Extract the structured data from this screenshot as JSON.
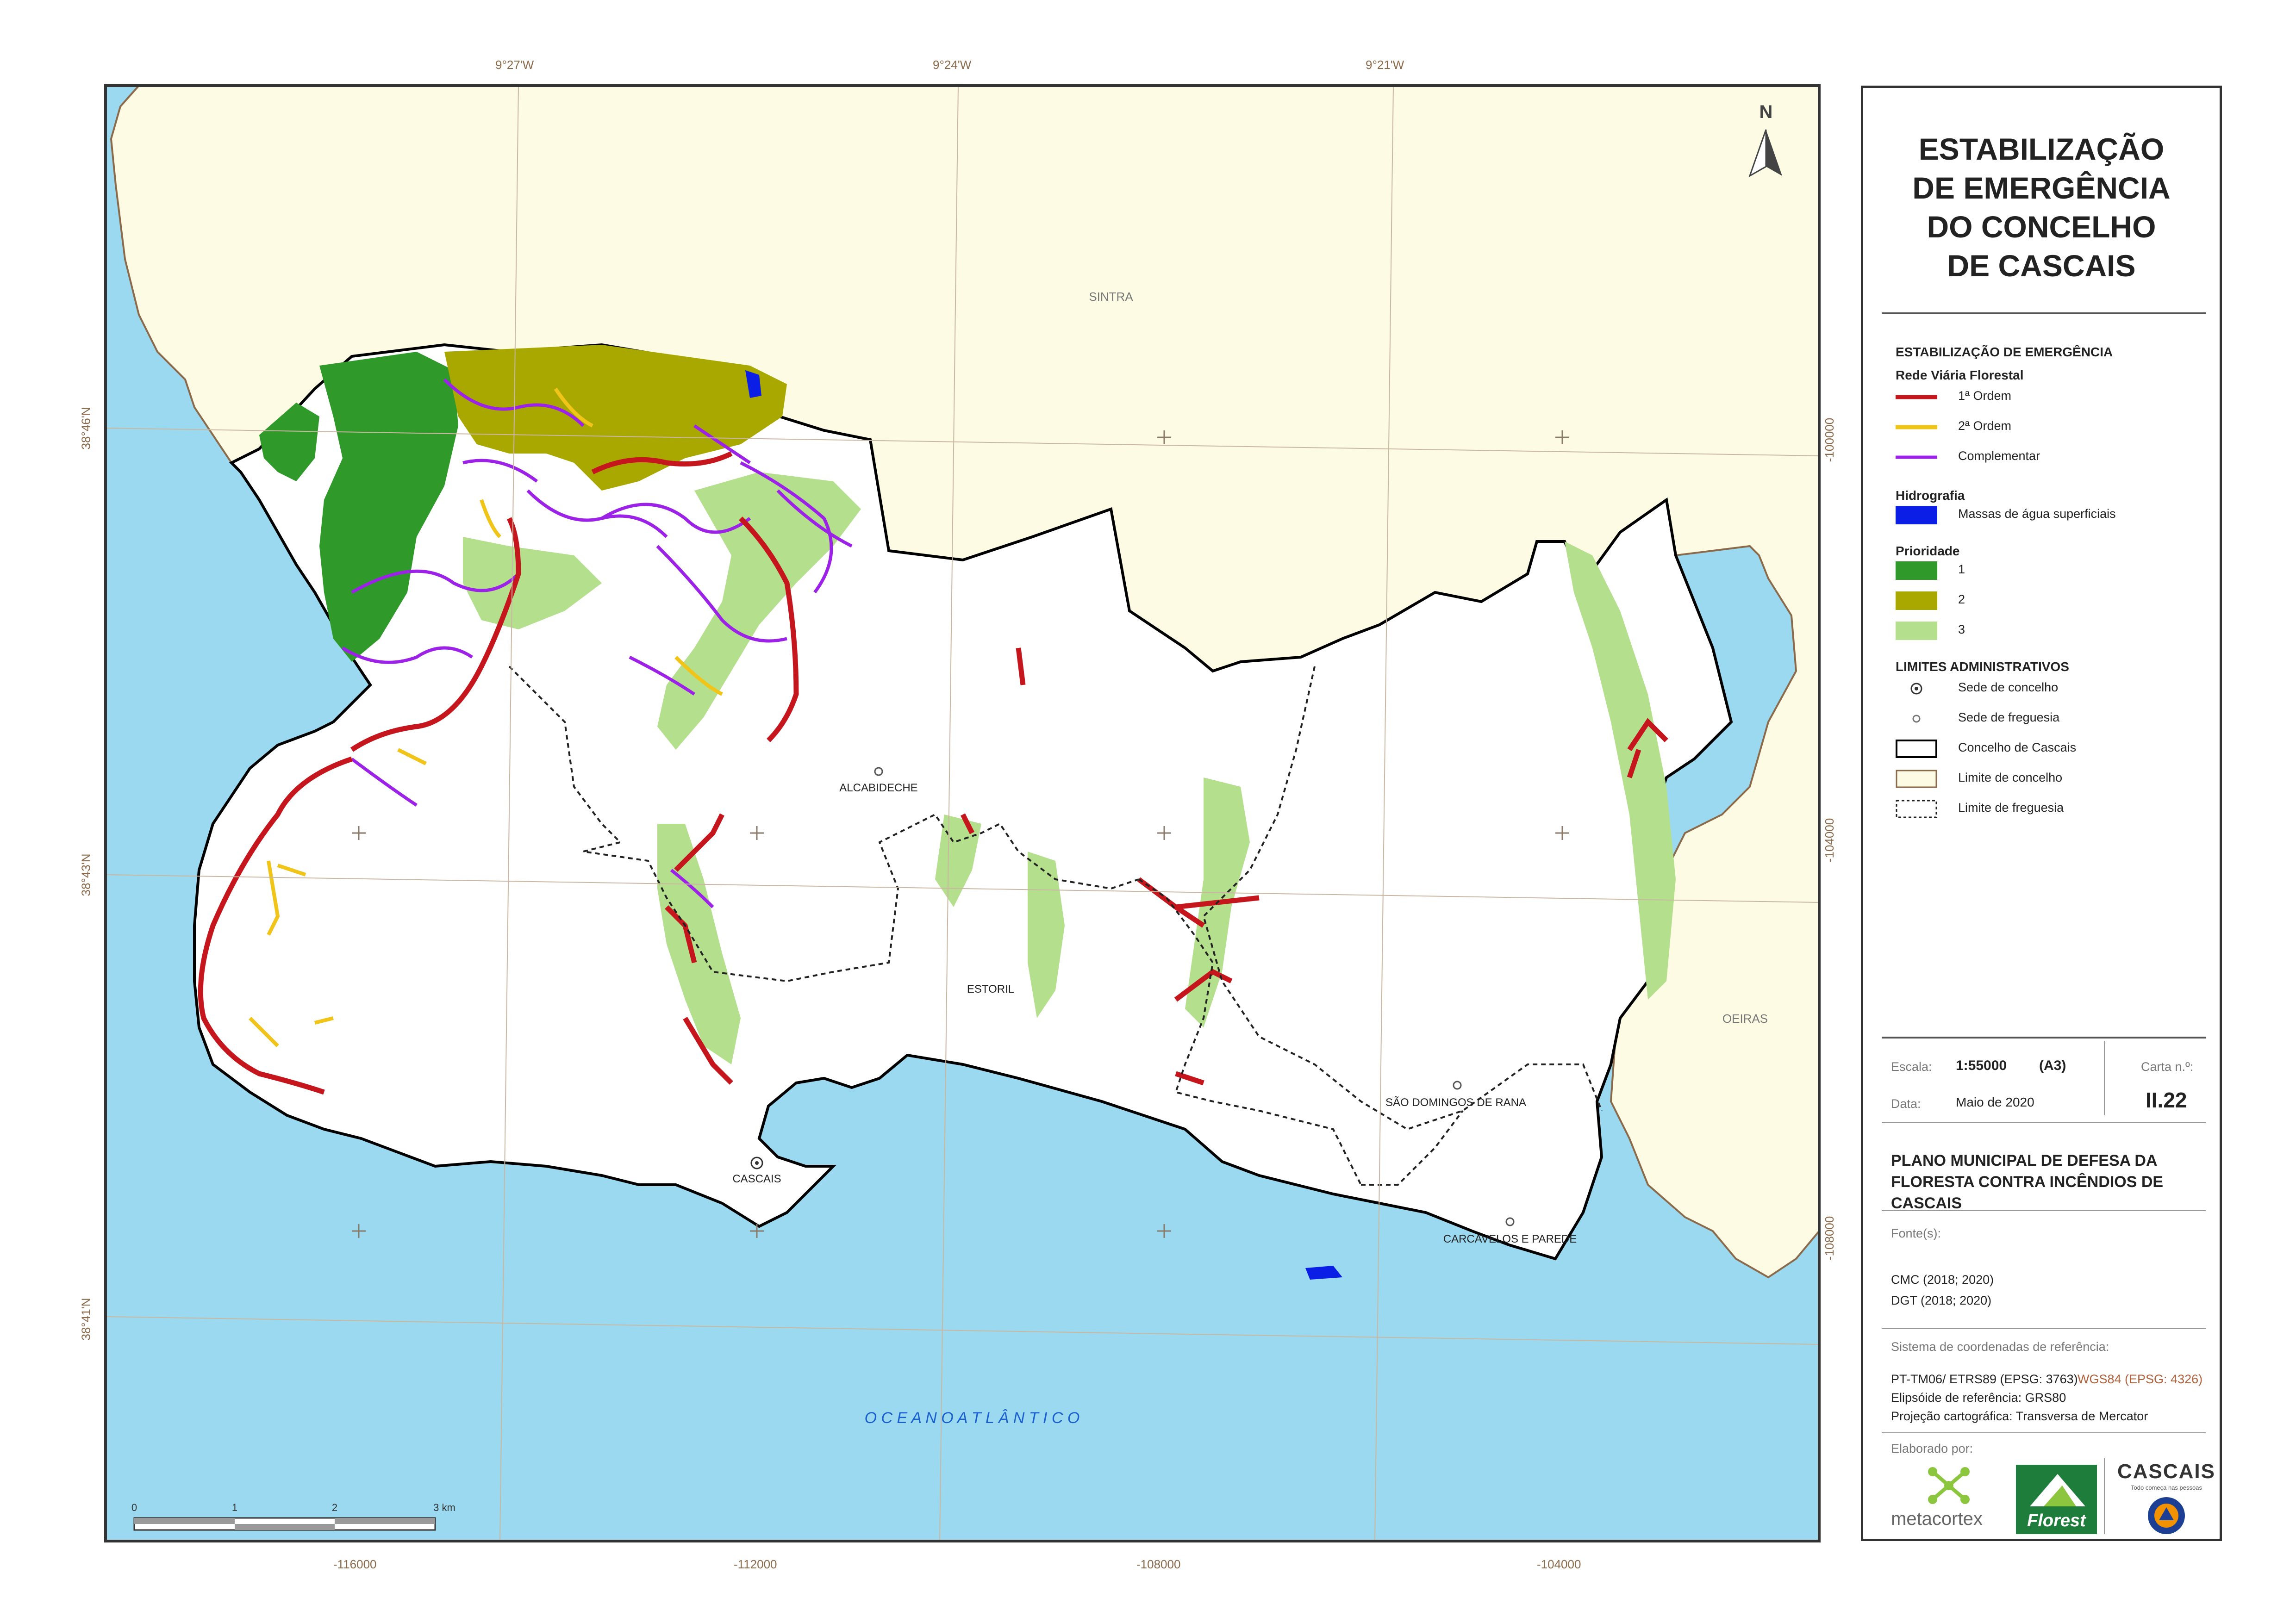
{
  "map": {
    "regions": {
      "sintra": "SINTRA",
      "oeiras": "OEIRAS",
      "ocean": "O C E A N O   A T L Â N T I C O"
    },
    "places": {
      "alcabideche": "ALCABIDECHE",
      "estoril": "ESTORIL",
      "sao_domingos": "SÃO DOMINGOS DE RANA",
      "cascais": "CASCAIS",
      "carcavelos": "CARCAVELOS E PAREDE"
    },
    "north_label": "N",
    "scalebar": {
      "t0": "0",
      "t1": "1",
      "t2": "2",
      "t3": "3 km"
    },
    "graticule_top": [
      "9°27'W",
      "9°24'W",
      "9°21'W"
    ],
    "graticule_left": [
      "38°46'N",
      "38°43'N",
      "38°41'N"
    ],
    "grid_bottom": [
      "-116000",
      "-112000",
      "-108000",
      "-104000"
    ],
    "grid_right": [
      "-100000",
      "-104000",
      "-108000"
    ]
  },
  "panel": {
    "title_lines": [
      "ESTABILIZAÇÃO",
      "DE EMERGÊNCIA",
      "DO CONCELHO",
      "DE CASCAIS"
    ],
    "legend": {
      "section": "ESTABILIZAÇÃO DE EMERGÊNCIA",
      "rede": "Rede Viária Florestal",
      "ordem1": "1ª Ordem",
      "ordem2": "2ª Ordem",
      "complementar": "Complementar",
      "hidro": "Hidrografia",
      "massas": "Massas de água superficiais",
      "prioridade": "Prioridade",
      "p1": "1",
      "p2": "2",
      "p3": "3",
      "limites": "LIMITES ADMINISTRATIVOS",
      "sede_concelho": "Sede de concelho",
      "sede_freguesia": "Sede de freguesia",
      "concelho_cascais": "Concelho de Cascais",
      "limite_concelho": "Limite de concelho",
      "limite_freguesia": "Limite de freguesia",
      "colors": {
        "ordem1": "#c4161c",
        "ordem2": "#f0c419",
        "complementar": "#9b22e6",
        "massas": "#0b1ee6",
        "p1": "#2f9a2a",
        "p2": "#a9a800",
        "p3": "#b4df8c",
        "limite_concelho_fill": "#fdfbe4"
      }
    },
    "meta": {
      "escala_label": "Escala:",
      "escala_value": "1:55000",
      "escala_format": "(A3)",
      "carta_label": "Carta n.º:",
      "carta_value": "II.22",
      "data_label": "Data:",
      "data_value": "Maio de 2020"
    },
    "plan_lines": [
      "PLANO MUNICIPAL DE DEFESA DA",
      "FLORESTA CONTRA INCÊNDIOS DE CASCAIS"
    ],
    "fontes_label": "Fonte(s):",
    "fontes": [
      "CMC (2018; 2020)",
      "DGT (2018; 2020)"
    ],
    "srs_label": "Sistema de coordenadas de referência:",
    "srs_main": "PT-TM06/ ETRS89 (EPSG: 3763)",
    "srs_wgs": "WGS84 (EPSG: 4326)",
    "ellipsoid": "Elipsóide de referência: GRS80",
    "projection": "Projeção cartográfica: Transversa de Mercator",
    "elaborado": "Elaborado por:",
    "logos": {
      "metacortex": "metacortex",
      "florest": "Florest",
      "cascais": "CASCAIS",
      "cascais_tag": "Todo começa nas pessoas"
    }
  }
}
